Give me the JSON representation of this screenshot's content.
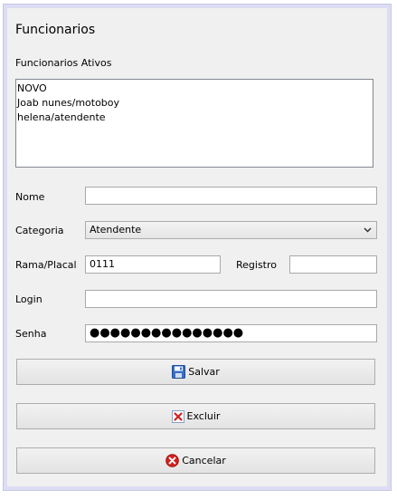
{
  "form": {
    "title": "Funcionarios",
    "list_label": "Funcionarios Ativos",
    "list_items": [
      "NOVO",
      "Joab nunes/motoboy",
      "helena/atendente"
    ],
    "fields": {
      "nome_label": "Nome",
      "nome_value": "",
      "categoria_label": "Categoria",
      "categoria_value": "Atendente",
      "rama_label": "Rama/Placal",
      "rama_value": "0111",
      "registro_label": "Registro",
      "registro_value": "",
      "login_label": "Login",
      "login_value": "",
      "senha_label": "Senha",
      "senha_value": "●●●●●●●●●●●●●●●"
    },
    "buttons": {
      "save_label": "Salvar",
      "delete_label": "Excluir",
      "cancel_label": "Cancelar"
    }
  },
  "icons": {
    "save": "save-icon",
    "delete": "delete-icon",
    "cancel": "cancel-icon",
    "dropdown": "chevron-down-icon"
  },
  "colors": {
    "window_border": "#dcdcf4",
    "panel_bg": "#f0f0f0",
    "delete_red": "#d42020",
    "save_blue": "#3a6ec0"
  }
}
